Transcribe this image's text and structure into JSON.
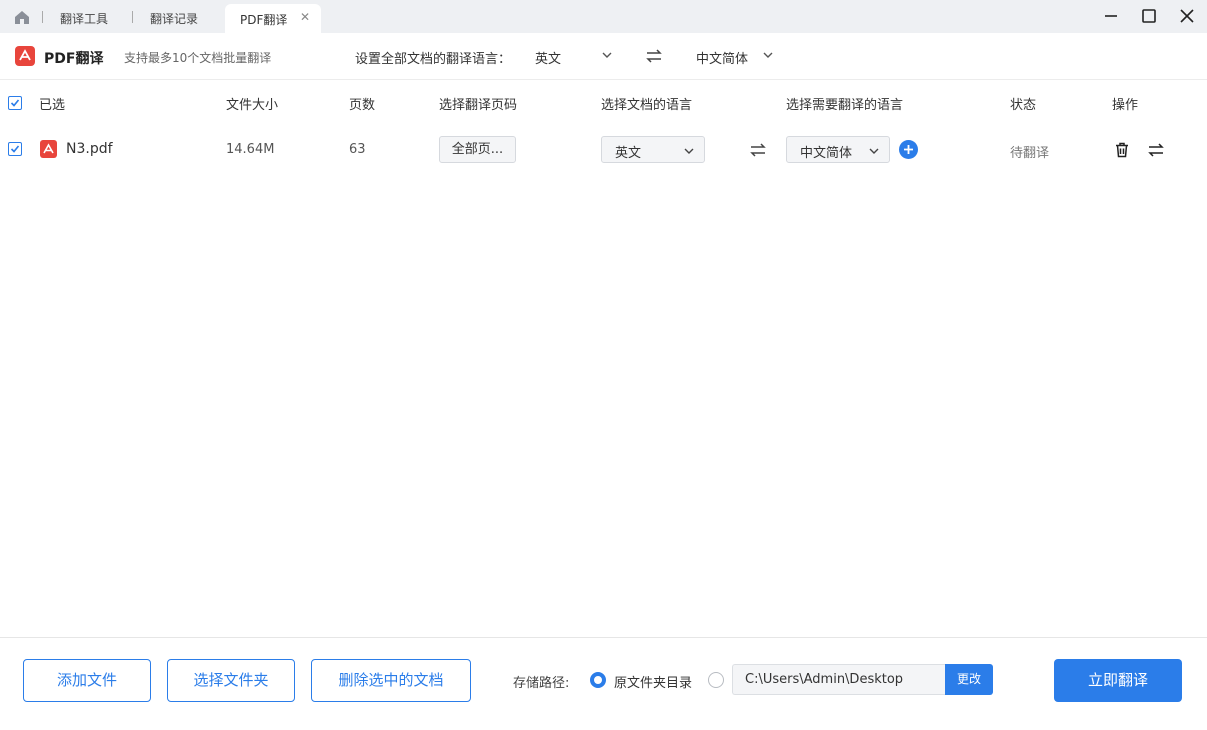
{
  "tabs": [
    {
      "label": "翻译工具"
    },
    {
      "label": "翻译记录"
    },
    {
      "label": "PDF翻译",
      "active": true
    }
  ],
  "toolbar": {
    "app_title": "PDF翻译",
    "subtitle": "支持最多10个文档批量翻译",
    "lang_label": "设置全部文档的翻译语言：",
    "source_lang": "英文",
    "target_lang": "中文简体"
  },
  "table": {
    "headers": {
      "selected": "已选",
      "size": "文件大小",
      "pages": "页数",
      "page_range": "选择翻译页码",
      "doc_lang": "选择文档的语言",
      "target_lang": "选择需要翻译的语言",
      "status": "状态",
      "actions": "操作"
    },
    "rows": [
      {
        "name": "N3.pdf",
        "size": "14.64M",
        "pages": "63",
        "page_range": "全部页...",
        "doc_lang": "英文",
        "target_lang": "中文简体",
        "status": "待翻译",
        "checked": true
      }
    ]
  },
  "footer": {
    "add_file": "添加文件",
    "select_folder": "选择文件夹",
    "delete_selected": "删除选中的文档",
    "save_label": "存储路径:",
    "option_original": "原文件夹目录",
    "custom_path": "C:\\Users\\Admin\\Desktop",
    "change": "更改",
    "translate_now": "立即翻译"
  },
  "colors": {
    "accent": "#2b7de9",
    "pdf_red": "#e8453c"
  }
}
